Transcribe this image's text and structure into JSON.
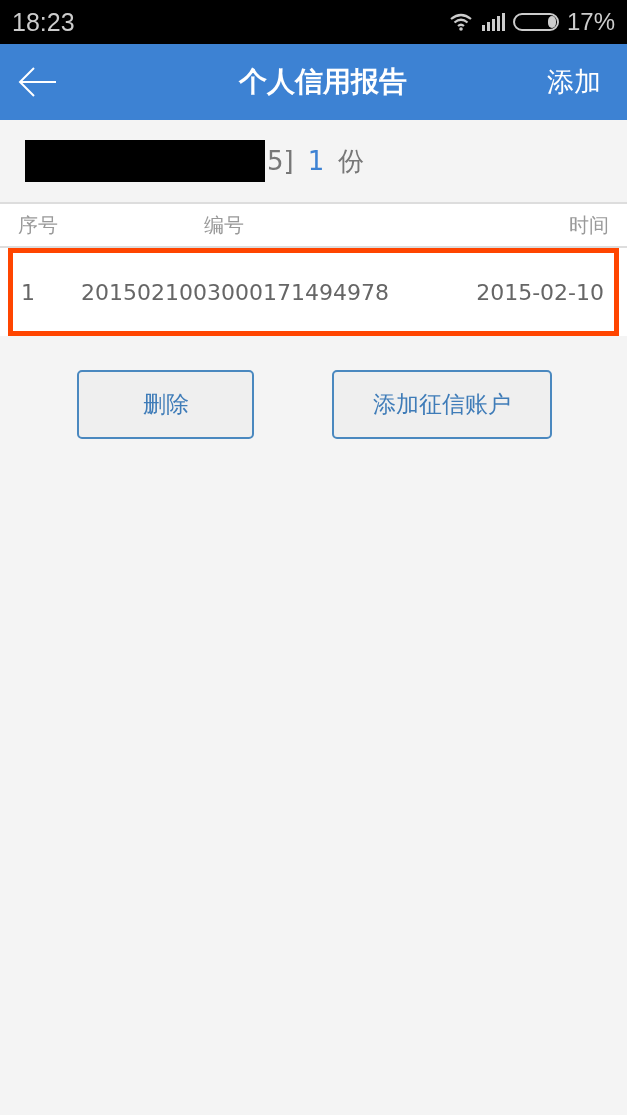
{
  "status_bar": {
    "time": "18:23",
    "battery": "17%"
  },
  "header": {
    "title": "个人信用报告",
    "action": "添加"
  },
  "summary": {
    "redacted": true,
    "tail": "5]",
    "count": "1",
    "unit": "份"
  },
  "table": {
    "columns": [
      "序号",
      "编号",
      "时间"
    ],
    "rows": [
      {
        "cells": [
          "1",
          "2015021003000171494978",
          "2015-02-10"
        ],
        "highlighted": true
      }
    ]
  },
  "buttons": [
    "删除",
    "添加征信账户"
  ]
}
